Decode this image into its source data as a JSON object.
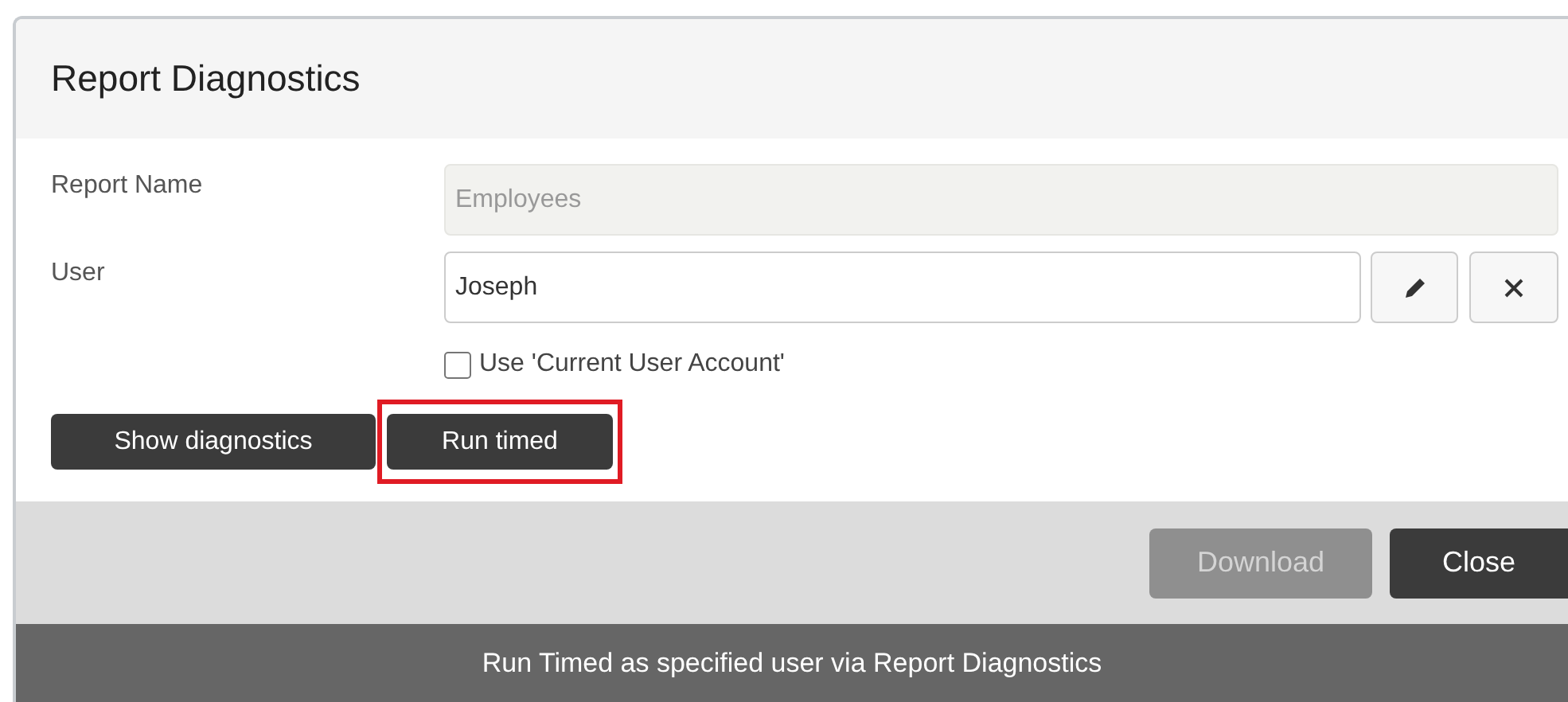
{
  "dialog": {
    "title": "Report Diagnostics"
  },
  "fields": [
    {
      "label": "Report Name",
      "value": "Employees",
      "disabled": true
    },
    {
      "label": "User",
      "value": "Joseph",
      "disabled": false
    }
  ],
  "use_current_user": {
    "label": "Use 'Current User Account'",
    "checked": false
  },
  "actions": [
    {
      "label": "Show diagnostics",
      "highlighted": false
    },
    {
      "label": "Run timed",
      "highlighted": true
    }
  ],
  "footer_buttons": [
    {
      "label": "Download",
      "disabled": true
    },
    {
      "label": "Close",
      "disabled": false
    }
  ],
  "caption": "Run Timed as specified user via Report Diagnostics"
}
